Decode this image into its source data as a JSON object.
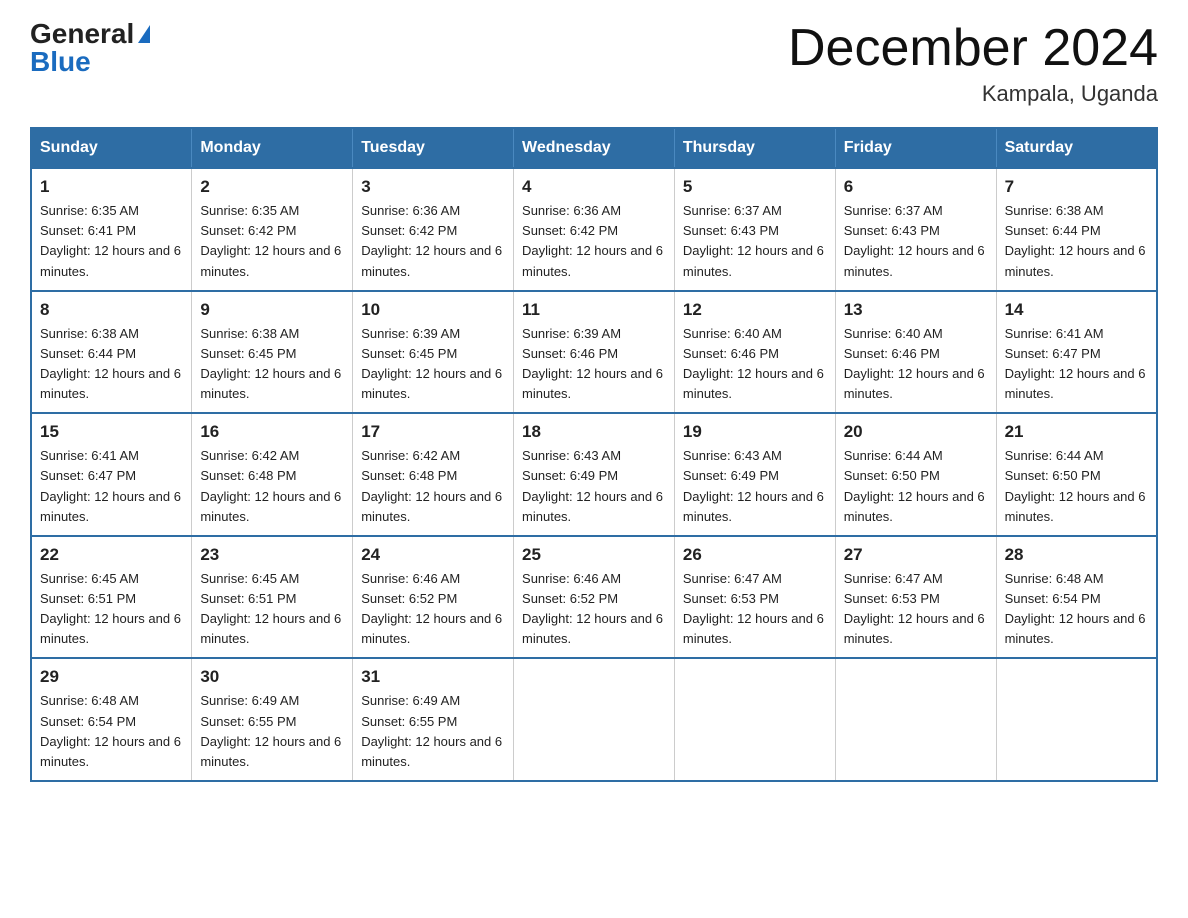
{
  "logo": {
    "general": "General",
    "blue": "Blue"
  },
  "title": "December 2024",
  "location": "Kampala, Uganda",
  "headers": [
    "Sunday",
    "Monday",
    "Tuesday",
    "Wednesday",
    "Thursday",
    "Friday",
    "Saturday"
  ],
  "weeks": [
    [
      {
        "day": "1",
        "sunrise": "6:35 AM",
        "sunset": "6:41 PM",
        "daylight": "12 hours and 6 minutes."
      },
      {
        "day": "2",
        "sunrise": "6:35 AM",
        "sunset": "6:42 PM",
        "daylight": "12 hours and 6 minutes."
      },
      {
        "day": "3",
        "sunrise": "6:36 AM",
        "sunset": "6:42 PM",
        "daylight": "12 hours and 6 minutes."
      },
      {
        "day": "4",
        "sunrise": "6:36 AM",
        "sunset": "6:42 PM",
        "daylight": "12 hours and 6 minutes."
      },
      {
        "day": "5",
        "sunrise": "6:37 AM",
        "sunset": "6:43 PM",
        "daylight": "12 hours and 6 minutes."
      },
      {
        "day": "6",
        "sunrise": "6:37 AM",
        "sunset": "6:43 PM",
        "daylight": "12 hours and 6 minutes."
      },
      {
        "day": "7",
        "sunrise": "6:38 AM",
        "sunset": "6:44 PM",
        "daylight": "12 hours and 6 minutes."
      }
    ],
    [
      {
        "day": "8",
        "sunrise": "6:38 AM",
        "sunset": "6:44 PM",
        "daylight": "12 hours and 6 minutes."
      },
      {
        "day": "9",
        "sunrise": "6:38 AM",
        "sunset": "6:45 PM",
        "daylight": "12 hours and 6 minutes."
      },
      {
        "day": "10",
        "sunrise": "6:39 AM",
        "sunset": "6:45 PM",
        "daylight": "12 hours and 6 minutes."
      },
      {
        "day": "11",
        "sunrise": "6:39 AM",
        "sunset": "6:46 PM",
        "daylight": "12 hours and 6 minutes."
      },
      {
        "day": "12",
        "sunrise": "6:40 AM",
        "sunset": "6:46 PM",
        "daylight": "12 hours and 6 minutes."
      },
      {
        "day": "13",
        "sunrise": "6:40 AM",
        "sunset": "6:46 PM",
        "daylight": "12 hours and 6 minutes."
      },
      {
        "day": "14",
        "sunrise": "6:41 AM",
        "sunset": "6:47 PM",
        "daylight": "12 hours and 6 minutes."
      }
    ],
    [
      {
        "day": "15",
        "sunrise": "6:41 AM",
        "sunset": "6:47 PM",
        "daylight": "12 hours and 6 minutes."
      },
      {
        "day": "16",
        "sunrise": "6:42 AM",
        "sunset": "6:48 PM",
        "daylight": "12 hours and 6 minutes."
      },
      {
        "day": "17",
        "sunrise": "6:42 AM",
        "sunset": "6:48 PM",
        "daylight": "12 hours and 6 minutes."
      },
      {
        "day": "18",
        "sunrise": "6:43 AM",
        "sunset": "6:49 PM",
        "daylight": "12 hours and 6 minutes."
      },
      {
        "day": "19",
        "sunrise": "6:43 AM",
        "sunset": "6:49 PM",
        "daylight": "12 hours and 6 minutes."
      },
      {
        "day": "20",
        "sunrise": "6:44 AM",
        "sunset": "6:50 PM",
        "daylight": "12 hours and 6 minutes."
      },
      {
        "day": "21",
        "sunrise": "6:44 AM",
        "sunset": "6:50 PM",
        "daylight": "12 hours and 6 minutes."
      }
    ],
    [
      {
        "day": "22",
        "sunrise": "6:45 AM",
        "sunset": "6:51 PM",
        "daylight": "12 hours and 6 minutes."
      },
      {
        "day": "23",
        "sunrise": "6:45 AM",
        "sunset": "6:51 PM",
        "daylight": "12 hours and 6 minutes."
      },
      {
        "day": "24",
        "sunrise": "6:46 AM",
        "sunset": "6:52 PM",
        "daylight": "12 hours and 6 minutes."
      },
      {
        "day": "25",
        "sunrise": "6:46 AM",
        "sunset": "6:52 PM",
        "daylight": "12 hours and 6 minutes."
      },
      {
        "day": "26",
        "sunrise": "6:47 AM",
        "sunset": "6:53 PM",
        "daylight": "12 hours and 6 minutes."
      },
      {
        "day": "27",
        "sunrise": "6:47 AM",
        "sunset": "6:53 PM",
        "daylight": "12 hours and 6 minutes."
      },
      {
        "day": "28",
        "sunrise": "6:48 AM",
        "sunset": "6:54 PM",
        "daylight": "12 hours and 6 minutes."
      }
    ],
    [
      {
        "day": "29",
        "sunrise": "6:48 AM",
        "sunset": "6:54 PM",
        "daylight": "12 hours and 6 minutes."
      },
      {
        "day": "30",
        "sunrise": "6:49 AM",
        "sunset": "6:55 PM",
        "daylight": "12 hours and 6 minutes."
      },
      {
        "day": "31",
        "sunrise": "6:49 AM",
        "sunset": "6:55 PM",
        "daylight": "12 hours and 6 minutes."
      },
      null,
      null,
      null,
      null
    ]
  ]
}
